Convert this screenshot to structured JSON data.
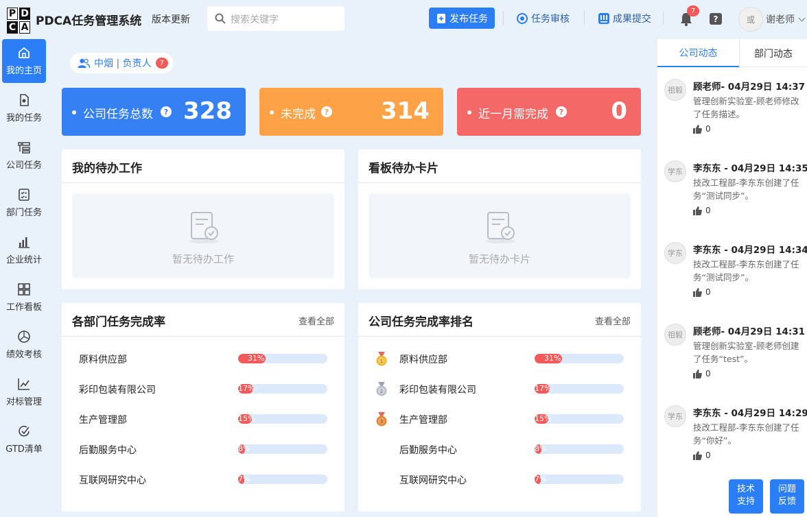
{
  "header": {
    "logo_letters": [
      "P",
      "D",
      "C",
      "A"
    ],
    "app_title": "PDCA任务管理系统",
    "version_label": "版本更新",
    "search_placeholder": "搜索关键字",
    "publish_label": "发布任务",
    "review_label": "任务审核",
    "submit_label": "成果提交",
    "bell_count": "7",
    "help_label": "?",
    "user_avatar_text": "或",
    "user_name": "谢老师"
  },
  "sidebar": {
    "items": [
      {
        "label": "我的主页",
        "icon": "home-icon",
        "active": true
      },
      {
        "label": "我的任务",
        "icon": "my-task-icon"
      },
      {
        "label": "公司任务",
        "icon": "company-task-icon"
      },
      {
        "label": "部门任务",
        "icon": "department-task-icon"
      },
      {
        "label": "企业统计",
        "icon": "bar-chart-icon"
      },
      {
        "label": "工作看板",
        "icon": "board-icon"
      },
      {
        "label": "绩效考核",
        "icon": "performance-icon"
      },
      {
        "label": "对标管理",
        "icon": "line-chart-icon"
      },
      {
        "label": "GTD清单",
        "icon": "checklist-icon"
      }
    ]
  },
  "role": {
    "label": "中烟 | 负责人",
    "count": "7"
  },
  "stats": [
    {
      "label": "公司任务总数",
      "value": "328",
      "color": "#3580f3"
    },
    {
      "label": "未完成",
      "value": "314",
      "color": "#fda247"
    },
    {
      "label": "近一月需完成",
      "value": "0",
      "color": "#f56868"
    }
  ],
  "todo": {
    "title": "我的待办工作",
    "empty_text": "暂无待办工作"
  },
  "board": {
    "title": "看板待办卡片",
    "empty_text": "暂无待办卡片"
  },
  "dept_rate": {
    "title": "各部门任务完成率",
    "more": "查看全部",
    "rows": [
      {
        "name": "原料供应部",
        "pct": "31%",
        "value": 0.31
      },
      {
        "name": "彩印包装有限公司",
        "pct": "17%",
        "value": 0.17
      },
      {
        "name": "生产管理部",
        "pct": "15%",
        "value": 0.15
      },
      {
        "name": "后勤服务中心",
        "pct": "8%",
        "value": 0.08
      },
      {
        "name": "互联网研究中心",
        "pct": "7%",
        "value": 0.07
      }
    ]
  },
  "company_rank": {
    "title": "公司任务完成率排名",
    "more": "查看全部",
    "rows": [
      {
        "name": "原料供应部",
        "pct": "31%",
        "value": 0.31,
        "medal": "gold"
      },
      {
        "name": "彩印包装有限公司",
        "pct": "17%",
        "value": 0.17,
        "medal": "silver"
      },
      {
        "name": "生产管理部",
        "pct": "15%",
        "value": 0.15,
        "medal": "bronze"
      },
      {
        "name": "后勤服务中心",
        "pct": "8%",
        "value": 0.08
      },
      {
        "name": "互联网研究中心",
        "pct": "7%",
        "value": 0.07
      }
    ]
  },
  "feed": {
    "tabs": [
      "公司动态",
      "部门动态"
    ],
    "items": [
      {
        "avatar": "祖毅",
        "header": "顾老师- 04月29日 14:37",
        "body": "管理创新实验室-顾老师修改了任务描述。",
        "likes": "0"
      },
      {
        "avatar": "学东",
        "header": "李东东 - 04月29日 14:35",
        "body": "技改工程部-李东东创建了任务“测试同步”。",
        "likes": "0"
      },
      {
        "avatar": "学东",
        "header": "李东东 - 04月29日 14:34",
        "body": "技改工程部-李东东创建了任务“测试同步”。",
        "likes": "0"
      },
      {
        "avatar": "祖毅",
        "header": "顾老师- 04月29日 14:31",
        "body": "管理创新实验室-顾老师创建了任务“test”。",
        "likes": "0"
      },
      {
        "avatar": "学东",
        "header": "李东东 - 04月29日 14:29",
        "body": "技改工程部-李东东创建了任务“你好”。",
        "likes": "0"
      }
    ]
  },
  "float_buttons": [
    {
      "line1": "技术",
      "line2": "支持"
    },
    {
      "line1": "问题",
      "line2": "反馈"
    }
  ]
}
